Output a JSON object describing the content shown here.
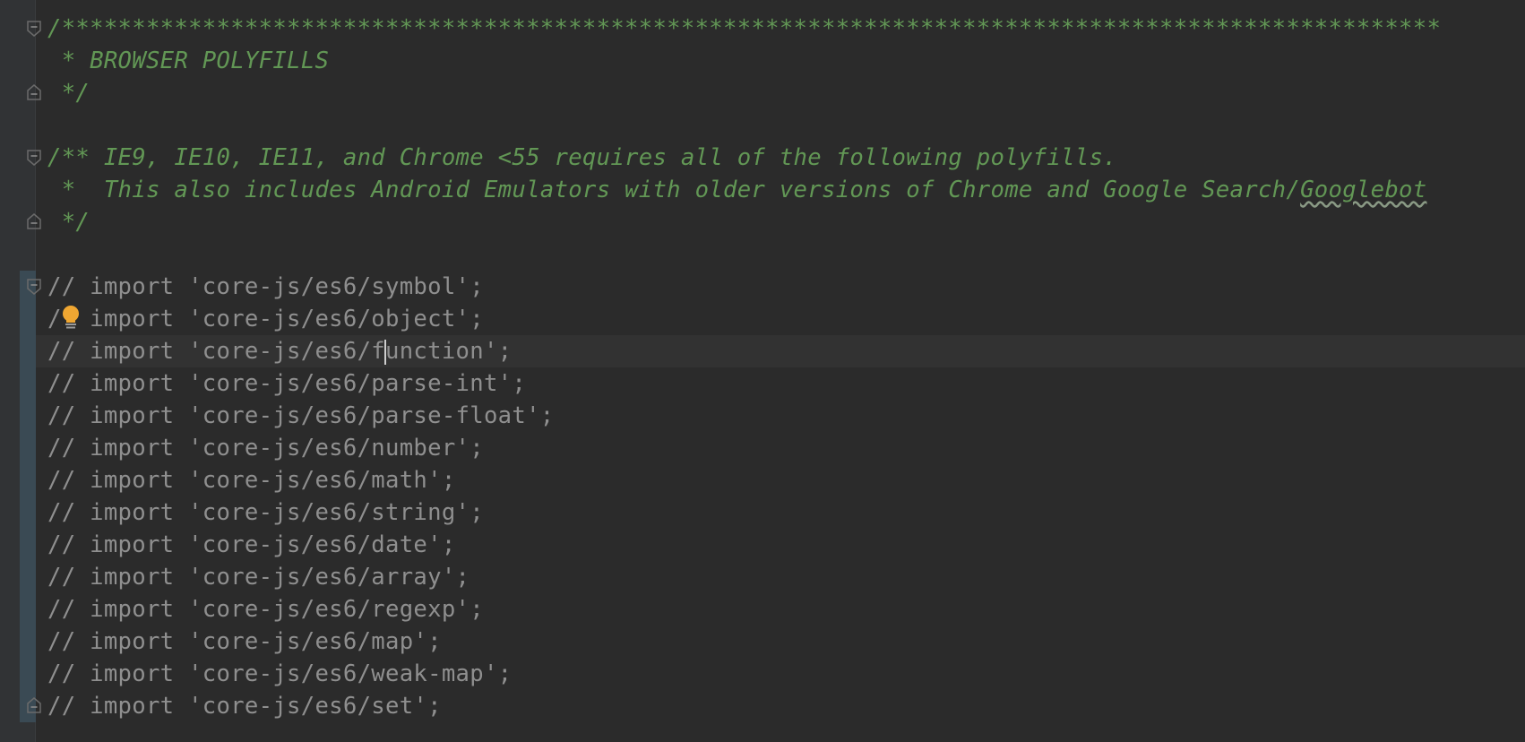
{
  "editor": {
    "lines": [
      {
        "kind": "doc",
        "text": "/**************************************************************************************************"
      },
      {
        "kind": "doc",
        "text": " * BROWSER POLYFILLS"
      },
      {
        "kind": "doc",
        "text": " */"
      },
      {
        "kind": "blank",
        "text": ""
      },
      {
        "kind": "doc",
        "text": "/** IE9, IE10, IE11, and Chrome <55 requires all of the following polyfills."
      },
      {
        "kind": "doc",
        "text": " *  This also includes Android Emulators with older versions of Chrome and Google Search/",
        "squiggle": "Googlebot"
      },
      {
        "kind": "doc",
        "text": " */"
      },
      {
        "kind": "blank",
        "text": ""
      },
      {
        "kind": "cmt",
        "text": "// import 'core-js/es6/symbol';"
      },
      {
        "kind": "cmt",
        "text": "// import 'core-js/es6/object';"
      },
      {
        "kind": "cmt",
        "before": "// import 'core-js/es6/f",
        "after": "unction';"
      },
      {
        "kind": "cmt",
        "text": "// import 'core-js/es6/parse-int';"
      },
      {
        "kind": "cmt",
        "text": "// import 'core-js/es6/parse-float';"
      },
      {
        "kind": "cmt",
        "text": "// import 'core-js/es6/number';"
      },
      {
        "kind": "cmt",
        "text": "// import 'core-js/es6/math';"
      },
      {
        "kind": "cmt",
        "text": "// import 'core-js/es6/string';"
      },
      {
        "kind": "cmt",
        "text": "// import 'core-js/es6/date';"
      },
      {
        "kind": "cmt",
        "text": "// import 'core-js/es6/array';"
      },
      {
        "kind": "cmt",
        "text": "// import 'core-js/es6/regexp';"
      },
      {
        "kind": "cmt",
        "text": "// import 'core-js/es6/map';"
      },
      {
        "kind": "cmt",
        "text": "// import 'core-js/es6/weak-map';"
      },
      {
        "kind": "cmt",
        "text": "// import 'core-js/es6/set';"
      }
    ]
  },
  "colors": {
    "background": "#2b2b2b",
    "doc_comment": "#629755",
    "line_comment": "#8f8f8f",
    "gutter": "#313335",
    "current_line": "#323232",
    "change_marker": "#3a4a54",
    "bulb": "#f0a732"
  },
  "icons": {
    "fold_start": "fold-start-icon",
    "fold_end": "fold-end-icon",
    "intention": "lightbulb-icon"
  }
}
